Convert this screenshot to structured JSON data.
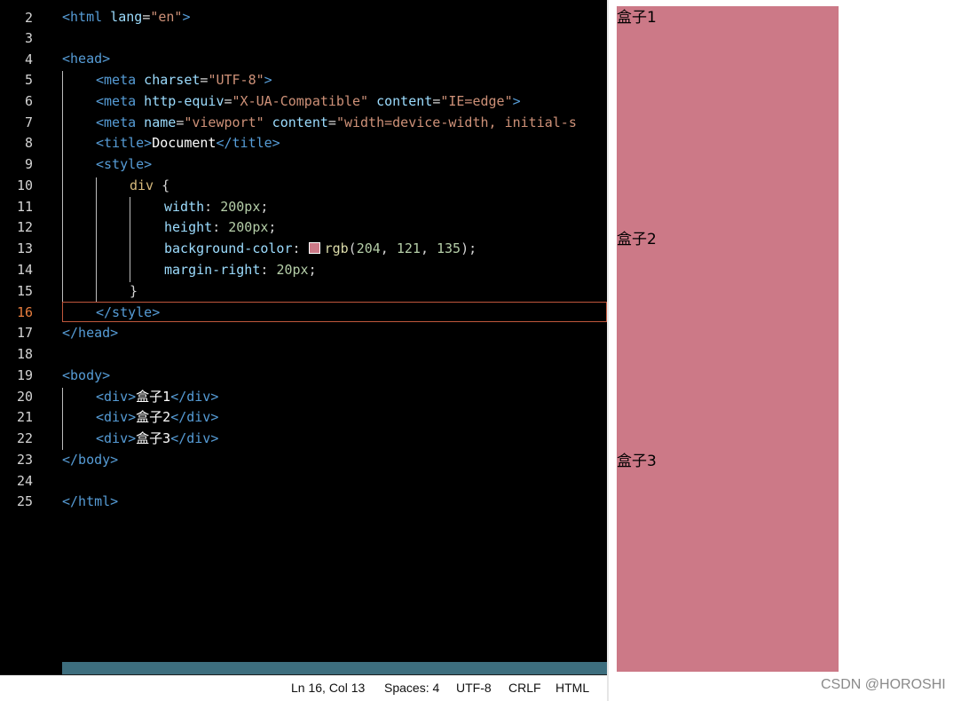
{
  "editor": {
    "line_numbers": [
      "2",
      "3",
      "4",
      "5",
      "6",
      "7",
      "8",
      "9",
      "10",
      "11",
      "12",
      "13",
      "14",
      "15",
      "16",
      "17",
      "18",
      "19",
      "20",
      "21",
      "22",
      "23",
      "24",
      "25"
    ],
    "active_line": "16",
    "code": {
      "l2": {
        "open": "<",
        "tag": "html",
        "attr": " lang",
        "eq": "=",
        "val": "\"en\"",
        "close": ">"
      },
      "l4": {
        "text": "<head>"
      },
      "l5": {
        "open": "<",
        "tag": "meta",
        "attr": " charset",
        "eq": "=",
        "val": "\"UTF-8\"",
        "close": ">"
      },
      "l6": {
        "open": "<",
        "tag": "meta",
        "attr1": " http-equiv",
        "eq1": "=",
        "val1": "\"X-UA-Compatible\"",
        "attr2": " content",
        "eq2": "=",
        "val2": "\"IE=edge\"",
        "close": ">"
      },
      "l7": {
        "open": "<",
        "tag": "meta",
        "attr1": " name",
        "eq1": "=",
        "val1": "\"viewport\"",
        "attr2": " content",
        "eq2": "=",
        "val2": "\"width=device-width, initial-s"
      },
      "l8": {
        "open": "<title>",
        "text": "Document",
        "close": "</title>"
      },
      "l9": {
        "text": "<style>"
      },
      "l10": {
        "selector": "div",
        "brace": " {"
      },
      "l11": {
        "prop": "width",
        "colon": ": ",
        "num": "200px",
        "semi": ";"
      },
      "l12": {
        "prop": "height",
        "colon": ": ",
        "num": "200px",
        "semi": ";"
      },
      "l13": {
        "prop": "background-color",
        "colon": ": ",
        "fn": "rgb",
        "paren_open": "(",
        "n1": "204",
        "c1": ", ",
        "n2": "121",
        "c2": ", ",
        "n3": "135",
        "paren_close": ");"
      },
      "l14": {
        "prop": "margin-right",
        "colon": ": ",
        "num": "20px",
        "semi": ";"
      },
      "l15": {
        "brace": "}"
      },
      "l16": {
        "text": "</style>"
      },
      "l17": {
        "text": "</head>"
      },
      "l19": {
        "text": "<body>"
      },
      "l20": {
        "open": "<div>",
        "text": "盒子1",
        "close": "</div>"
      },
      "l21": {
        "open": "<div>",
        "text": "盒子2",
        "close": "</div>"
      },
      "l22": {
        "open": "<div>",
        "text": "盒子3",
        "close": "</div>"
      },
      "l23": {
        "text": "</body>"
      },
      "l25": {
        "text": "</html>"
      }
    },
    "swatch_color": "#cc7987"
  },
  "statusbar": {
    "position": "Ln 16, Col 13",
    "spaces": "Spaces: 4",
    "encoding": "UTF-8",
    "eol": "CRLF",
    "language": "HTML"
  },
  "preview": {
    "boxes": [
      {
        "label": "盒子1"
      },
      {
        "label": "盒子2"
      },
      {
        "label": "盒子3"
      }
    ],
    "box_color": "#cc7987"
  },
  "watermark": "CSDN @HOROSHI"
}
